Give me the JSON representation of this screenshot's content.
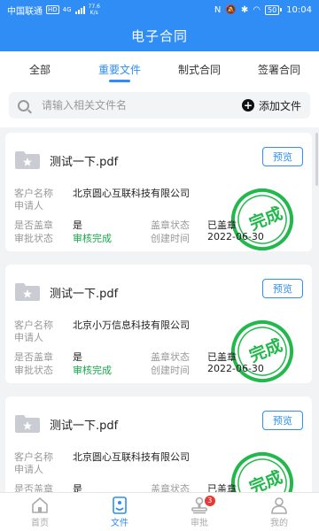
{
  "status_bar": {
    "carrier": "中国联通",
    "hd": "HD",
    "network": "4G",
    "speed_value": "77.6",
    "speed_unit": "K/s",
    "battery": "50",
    "time": "10:04"
  },
  "header": {
    "title": "电子合同"
  },
  "tabs": [
    {
      "label": "全部",
      "active": false
    },
    {
      "label": "重要文件",
      "active": true
    },
    {
      "label": "制式合同",
      "active": false
    },
    {
      "label": "签署合同",
      "active": false
    }
  ],
  "search": {
    "placeholder": "请输入相关文件名",
    "value": "",
    "add_label": "添加文件"
  },
  "field_labels": {
    "customer": "客户名称",
    "applicant": "申请人",
    "sealed": "是否盖章",
    "seal_status": "盖章状态",
    "approval_status": "审批状态",
    "created_time": "创建时间"
  },
  "preview_label": "预览",
  "stamp_text": "完成",
  "cards": [
    {
      "filename": "测试一下.pdf",
      "customer": "北京圆心互联科技有限公司",
      "applicant": "",
      "sealed": "是",
      "seal_status": "已盖章",
      "approval_status": "审核完成",
      "created_time": "2022-06-30"
    },
    {
      "filename": "测试一下.pdf",
      "customer": "北京小万信息科技有限公司",
      "applicant": "",
      "sealed": "是",
      "seal_status": "已盖章",
      "approval_status": "审核完成",
      "created_time": "2022-06-30"
    },
    {
      "filename": "测试一下.pdf",
      "customer": "北京圆心互联科技有限公司",
      "applicant": "",
      "sealed": "是",
      "seal_status": "已盖章",
      "approval_status": "",
      "created_time": ""
    }
  ],
  "bottom_nav": [
    {
      "label": "首页",
      "icon": "home-icon",
      "active": false
    },
    {
      "label": "文件",
      "icon": "file-icon",
      "active": true
    },
    {
      "label": "审批",
      "icon": "stamp-icon",
      "active": false,
      "badge": "3"
    },
    {
      "label": "我的",
      "icon": "user-icon",
      "active": false
    }
  ],
  "colors": {
    "primary": "#2f8df5",
    "approved_green": "#1aa84a",
    "stamp_green": "#22b84c",
    "badge_red": "#e53935"
  }
}
